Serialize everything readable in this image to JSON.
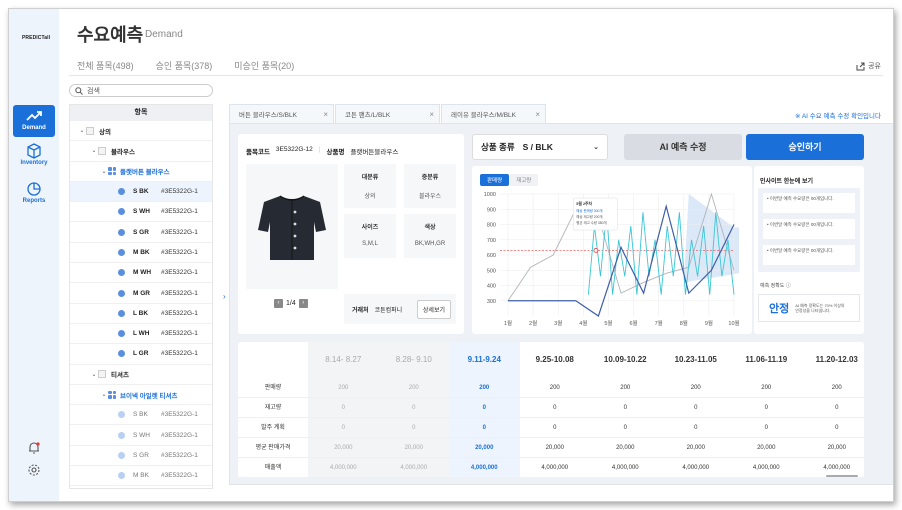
{
  "app": {
    "logo": "PREDICTall",
    "title": "수요예측",
    "title_en": "Demand"
  },
  "nav": [
    {
      "label": "Demand",
      "icon": "trend-up-icon",
      "active": true
    },
    {
      "label": "Inventory",
      "icon": "box-icon"
    },
    {
      "label": "Reports",
      "icon": "pie-chart-icon"
    }
  ],
  "tabs": [
    "전체 품목(498)",
    "승인 품목(378)",
    "미승인 품목(20)"
  ],
  "share_label": "공유",
  "search_placeholder": "검색",
  "tree": {
    "header": "항목",
    "rows": [
      {
        "type": "l0",
        "label": "상의"
      },
      {
        "type": "l1",
        "label": "블라우스"
      },
      {
        "type": "l2",
        "label": "플랫버튼 블라우스"
      },
      {
        "type": "sku",
        "size": "S",
        "color": "BK",
        "code": "#3E5322G-1",
        "active": true
      },
      {
        "type": "sku",
        "size": "S",
        "color": "WH",
        "code": "#3E5322G-1"
      },
      {
        "type": "sku",
        "size": "S",
        "color": "GR",
        "code": "#3E5322G-1"
      },
      {
        "type": "sku",
        "size": "M",
        "color": "BK",
        "code": "#3E5322G-1"
      },
      {
        "type": "sku",
        "size": "M",
        "color": "WH",
        "code": "#3E5322G-1"
      },
      {
        "type": "sku",
        "size": "M",
        "color": "GR",
        "code": "#3E5322G-1"
      },
      {
        "type": "sku",
        "size": "L",
        "color": "BK",
        "code": "#3E5322G-1"
      },
      {
        "type": "sku",
        "size": "L",
        "color": "WH",
        "code": "#3E5322G-1"
      },
      {
        "type": "sku",
        "size": "L",
        "color": "GR",
        "code": "#3E5322G-1"
      },
      {
        "type": "l1",
        "label": "티셔츠"
      },
      {
        "type": "l2",
        "label": "브이넥 아일렛 티셔츠"
      },
      {
        "type": "sku-grey",
        "size": "S",
        "color": "BK",
        "code": "#3E5322G-1"
      },
      {
        "type": "sku-grey",
        "size": "S",
        "color": "WH",
        "code": "#3E5322G-1"
      },
      {
        "type": "sku-grey",
        "size": "S",
        "color": "GR",
        "code": "#3E5322G-1"
      },
      {
        "type": "sku-grey",
        "size": "M",
        "color": "BK",
        "code": "#3E5322G-1"
      }
    ]
  },
  "product_tabs": [
    {
      "label": "버튼 블라우스/S/BLK"
    },
    {
      "label": "코튼 팬츠/L/BLK"
    },
    {
      "label": "레이유 블라우스/M/BLK"
    }
  ],
  "hint": "※ AI 수요 예측 수정 확인입니다",
  "product": {
    "code_label": "품목코드",
    "code": "3E5322G-12",
    "name_label": "상품명",
    "name": "플랫버튼블라우스",
    "page": "1/4",
    "attrs": [
      {
        "k": "대분류",
        "v": "상의"
      },
      {
        "k": "중분류",
        "v": "블라우스"
      },
      {
        "k": "사이즈",
        "v": "S,M,L"
      },
      {
        "k": "색상",
        "v": "BK,WH,GR"
      }
    ],
    "vendor_label": "거래처",
    "vendor": "코튼컴퍼니",
    "detail_button": "상세보기"
  },
  "type_select": {
    "label": "상품 종류",
    "value": "S / BLK"
  },
  "buttons": {
    "ai": "AI 예측 수정",
    "approve": "승인하기"
  },
  "chart_toggle": [
    "판매량",
    "재고량"
  ],
  "chart_data": {
    "type": "line",
    "x": [
      "1월",
      "2월",
      "3월",
      "4월",
      "5월",
      "6월",
      "7월",
      "8월",
      "9월",
      "10월"
    ],
    "y_ticks": [
      300,
      400,
      500,
      600,
      700,
      800,
      900,
      1000
    ],
    "ylim": [
      200,
      1000
    ],
    "reference_line": 630,
    "series": [
      {
        "values": [
          300,
          520,
          600,
          900,
          850,
          350,
          420,
          480,
          520,
          1000,
          500
        ]
      },
      {
        "values": [
          300,
          300,
          300,
          300,
          200,
          650,
          350,
          920,
          350,
          500,
          800
        ]
      }
    ],
    "tooltip": {
      "title": "5월 2주차",
      "lines": [
        "예상 판매량 300개",
        "예상 재고량 200개",
        "평균 재고 수량 380개"
      ]
    }
  },
  "insight": {
    "title": "인사이트 한눈에 보기",
    "items": [
      "• 이번달 예측 수요량은 00개입니다.",
      "• 이번달 예측 수요량은 00개입니다.",
      "• 이번달 예측 수요량은 00개입니다."
    ],
    "accuracy_label": "예측 정확도 ⓘ",
    "accuracy_value": "안정",
    "accuracy_desc": "AI 예측 정확도는 70% 이상의 안정성을 나타냅니다."
  },
  "table": {
    "row_labels": [
      "판매량",
      "재고량",
      "발주 계획",
      "평균 판매가격",
      "매출액"
    ],
    "columns": [
      {
        "period": "8.14- 8.27",
        "state": "past",
        "values": [
          "200",
          "0",
          "0",
          "20,000",
          "4,000,000"
        ]
      },
      {
        "period": "8.28- 9.10",
        "state": "past",
        "values": [
          "200",
          "0",
          "0",
          "20,000",
          "4,000,000"
        ]
      },
      {
        "period": "9.11-9.24",
        "state": "current",
        "values": [
          "200",
          "0",
          "0",
          "20,000",
          "4,000,000"
        ]
      },
      {
        "period": "9.25-10.08",
        "state": "future",
        "values": [
          "200",
          "0",
          "0",
          "20,000",
          "4,000,000"
        ]
      },
      {
        "period": "10.09-10.22",
        "state": "future",
        "values": [
          "200",
          "0",
          "0",
          "20,000",
          "4,000,000"
        ]
      },
      {
        "period": "10.23-11.05",
        "state": "future",
        "values": [
          "200",
          "0",
          "0",
          "20,000",
          "4,000,000"
        ]
      },
      {
        "period": "11.06-11.19",
        "state": "future",
        "values": [
          "200",
          "0",
          "0",
          "20,000",
          "4,000,000"
        ]
      },
      {
        "period": "11.20-12.03",
        "state": "future",
        "values": [
          "200",
          "0",
          "0",
          "20,000",
          "4,000,000"
        ]
      }
    ]
  },
  "colors": {
    "accent": "#1a6fd8",
    "series_teal": "#3bc6d6",
    "series_navy": "#3f5ea8"
  }
}
